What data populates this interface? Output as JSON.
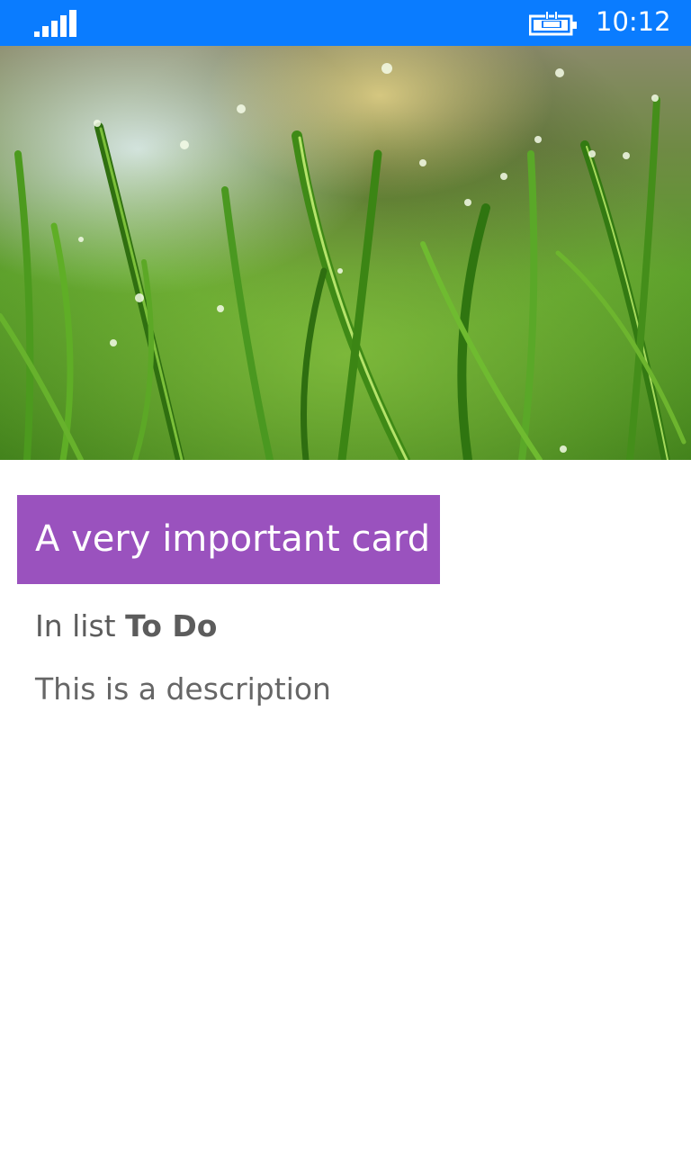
{
  "status_bar": {
    "time": "10:12",
    "signal_icon": "signal-bars-icon",
    "battery_icon": "battery-charging-icon",
    "background_color": "#0a7cff"
  },
  "hero_image": {
    "subject": "grass-with-dew-drops"
  },
  "card": {
    "title": "A very important card",
    "title_background": "#9a52be",
    "list_prefix": "In list",
    "list_name": "To Do",
    "description": "This is a description"
  }
}
